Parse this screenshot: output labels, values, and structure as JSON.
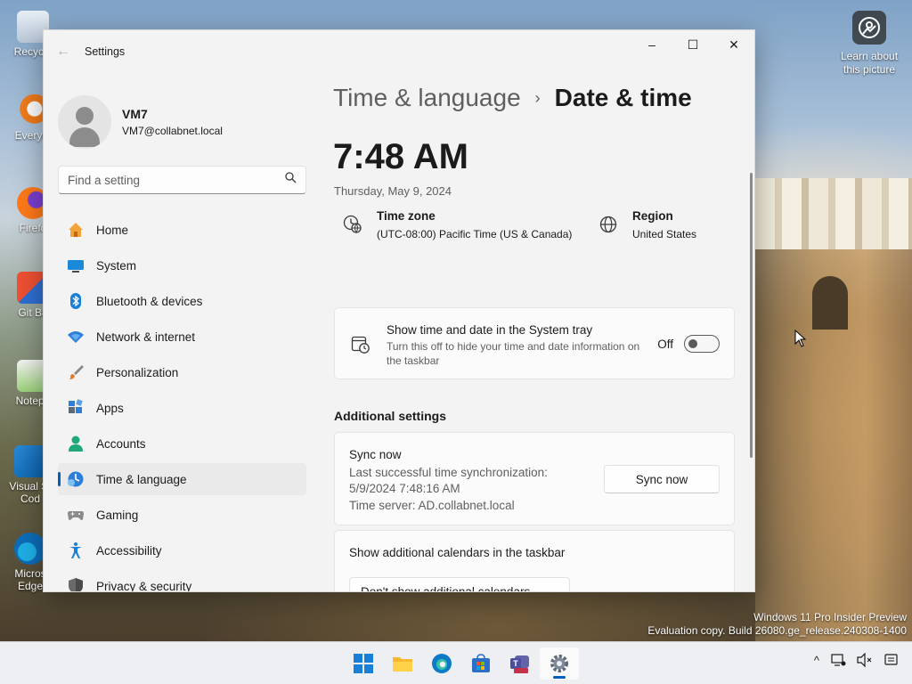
{
  "desktop": {
    "icons": [
      {
        "label": "Recycle",
        "name": "recycle-bin"
      },
      {
        "label": "Everyth",
        "name": "everything"
      },
      {
        "label": "Firefo",
        "name": "firefox"
      },
      {
        "label": "Git Ba",
        "name": "git-bash"
      },
      {
        "label": "Notepa",
        "name": "notepad"
      },
      {
        "label": "Visual St Cod",
        "name": "vscode"
      },
      {
        "label": "Micros Edge",
        "name": "edge"
      }
    ],
    "learn_label": "Learn about this picture",
    "watermark_line1": "Windows 11 Pro Insider Preview",
    "watermark_line2": "Evaluation copy. Build 26080.ge_release.240308-1400"
  },
  "window": {
    "title": "Settings",
    "back_icon": "back-arrow-icon",
    "controls": {
      "minimize": "–",
      "maximize": "☐",
      "close": "✕"
    }
  },
  "profile": {
    "name": "VM7",
    "email": "VM7@collabnet.local"
  },
  "search": {
    "placeholder": "Find a setting"
  },
  "nav": [
    {
      "label": "Home",
      "icon": "home-icon"
    },
    {
      "label": "System",
      "icon": "system-icon"
    },
    {
      "label": "Bluetooth & devices",
      "icon": "bluetooth-icon"
    },
    {
      "label": "Network & internet",
      "icon": "network-icon"
    },
    {
      "label": "Personalization",
      "icon": "brush-icon"
    },
    {
      "label": "Apps",
      "icon": "apps-icon"
    },
    {
      "label": "Accounts",
      "icon": "accounts-icon"
    },
    {
      "label": "Time & language",
      "icon": "time-language-icon",
      "active": true
    },
    {
      "label": "Gaming",
      "icon": "gaming-icon"
    },
    {
      "label": "Accessibility",
      "icon": "accessibility-icon"
    },
    {
      "label": "Privacy & security",
      "icon": "shield-icon"
    }
  ],
  "breadcrumb": {
    "parent": "Time & language",
    "separator": "›",
    "current": "Date & time"
  },
  "clock": {
    "time": "7:48 AM",
    "date": "Thursday, May 9, 2024"
  },
  "timezone": {
    "label": "Time zone",
    "value": "(UTC-08:00) Pacific Time (US & Canada)"
  },
  "region": {
    "label": "Region",
    "value": "United States"
  },
  "tray_setting": {
    "title": "Show time and date in the System tray",
    "description": "Turn this off to hide your time and date information on the taskbar",
    "state_label": "Off",
    "on": false
  },
  "additional": {
    "title": "Additional settings",
    "sync": {
      "title": "Sync now",
      "line1": "Last successful time synchronization:",
      "line2": "5/9/2024 7:48:16 AM",
      "line3": "Time server: AD.collabnet.local",
      "button": "Sync now"
    },
    "calendars": {
      "title": "Show additional calendars in the taskbar",
      "selected": "Don't show additional calendars"
    }
  },
  "taskbar": {
    "apps": [
      "start-icon",
      "file-explorer-icon",
      "edge-icon",
      "store-icon",
      "teams-icon",
      "settings-icon"
    ],
    "tray_chevron": "^"
  },
  "colors": {
    "accent": "#005fb8",
    "window_bg": "#f3f3f3",
    "card_bg": "#fbfbfb"
  }
}
